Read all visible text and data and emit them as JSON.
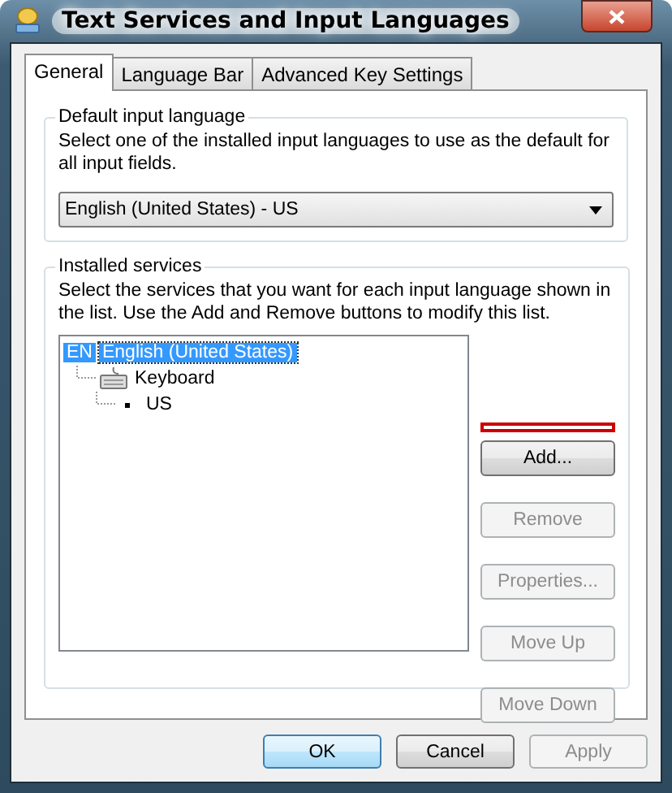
{
  "window": {
    "title": "Text Services and Input Languages"
  },
  "tabs": [
    {
      "label": "General",
      "selected": true
    },
    {
      "label": "Language Bar",
      "selected": false
    },
    {
      "label": "Advanced Key Settings",
      "selected": false
    }
  ],
  "default_input_language": {
    "legend": "Default input language",
    "description": "Select one of the installed input languages to use as the default for all input fields.",
    "value": "English (United States) - US"
  },
  "installed_services": {
    "legend": "Installed services",
    "description": "Select the services that you want for each input language shown in the list. Use the Add and Remove buttons to modify this list.",
    "tree": [
      {
        "kind": "language",
        "badge": "EN",
        "label": "English (United States)",
        "selected": true,
        "children": [
          {
            "kind": "category",
            "label": "Keyboard",
            "selected": false,
            "children": [
              {
                "kind": "layout",
                "label": "US",
                "selected": false
              }
            ]
          }
        ]
      }
    ],
    "buttons": [
      {
        "label": "Add...",
        "disabled": false,
        "highlighted": true
      },
      {
        "label": "Remove",
        "disabled": true,
        "highlighted": false
      },
      {
        "label": "Properties...",
        "disabled": true,
        "highlighted": false
      },
      {
        "label": "Move Up",
        "disabled": true,
        "highlighted": false
      },
      {
        "label": "Move Down",
        "disabled": true,
        "highlighted": false
      }
    ]
  },
  "footer_buttons": [
    {
      "label": "OK",
      "disabled": false,
      "default": true
    },
    {
      "label": "Cancel",
      "disabled": false,
      "default": false
    },
    {
      "label": "Apply",
      "disabled": true,
      "default": false
    }
  ]
}
